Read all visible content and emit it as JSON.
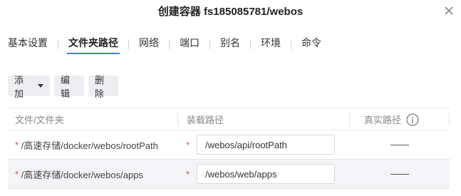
{
  "dialog": {
    "title": "创建容器 fs185085781/webos"
  },
  "tabs": [
    {
      "label": "基本设置"
    },
    {
      "label": "文件夹路径"
    },
    {
      "label": "网络"
    },
    {
      "label": "端口"
    },
    {
      "label": "别名"
    },
    {
      "label": "环境"
    },
    {
      "label": "命令"
    }
  ],
  "active_tab": "文件夹路径",
  "toolbar": {
    "add_label": "添加",
    "edit_label": "编辑",
    "delete_label": "删除"
  },
  "table": {
    "headers": {
      "folder": "文件/文件夹",
      "mount_path": "装载路径",
      "real_path": "真实路径"
    },
    "required_mark": "*",
    "rows": [
      {
        "folder": "/高速存储/docker/webos/rootPath",
        "mount_path": "/webos/api/rootPath"
      },
      {
        "folder": "/高速存储/docker/webos/apps",
        "mount_path": "/webos/web/apps"
      }
    ]
  },
  "colors": {
    "accent": "#3d7ef7",
    "required": "#e05050",
    "button_bg": "#eceef1",
    "alt_row_bg": "#f3f4f7"
  },
  "icons": {
    "close": "close-icon",
    "dropdown": "caret-down-icon",
    "info": "info-icon"
  }
}
